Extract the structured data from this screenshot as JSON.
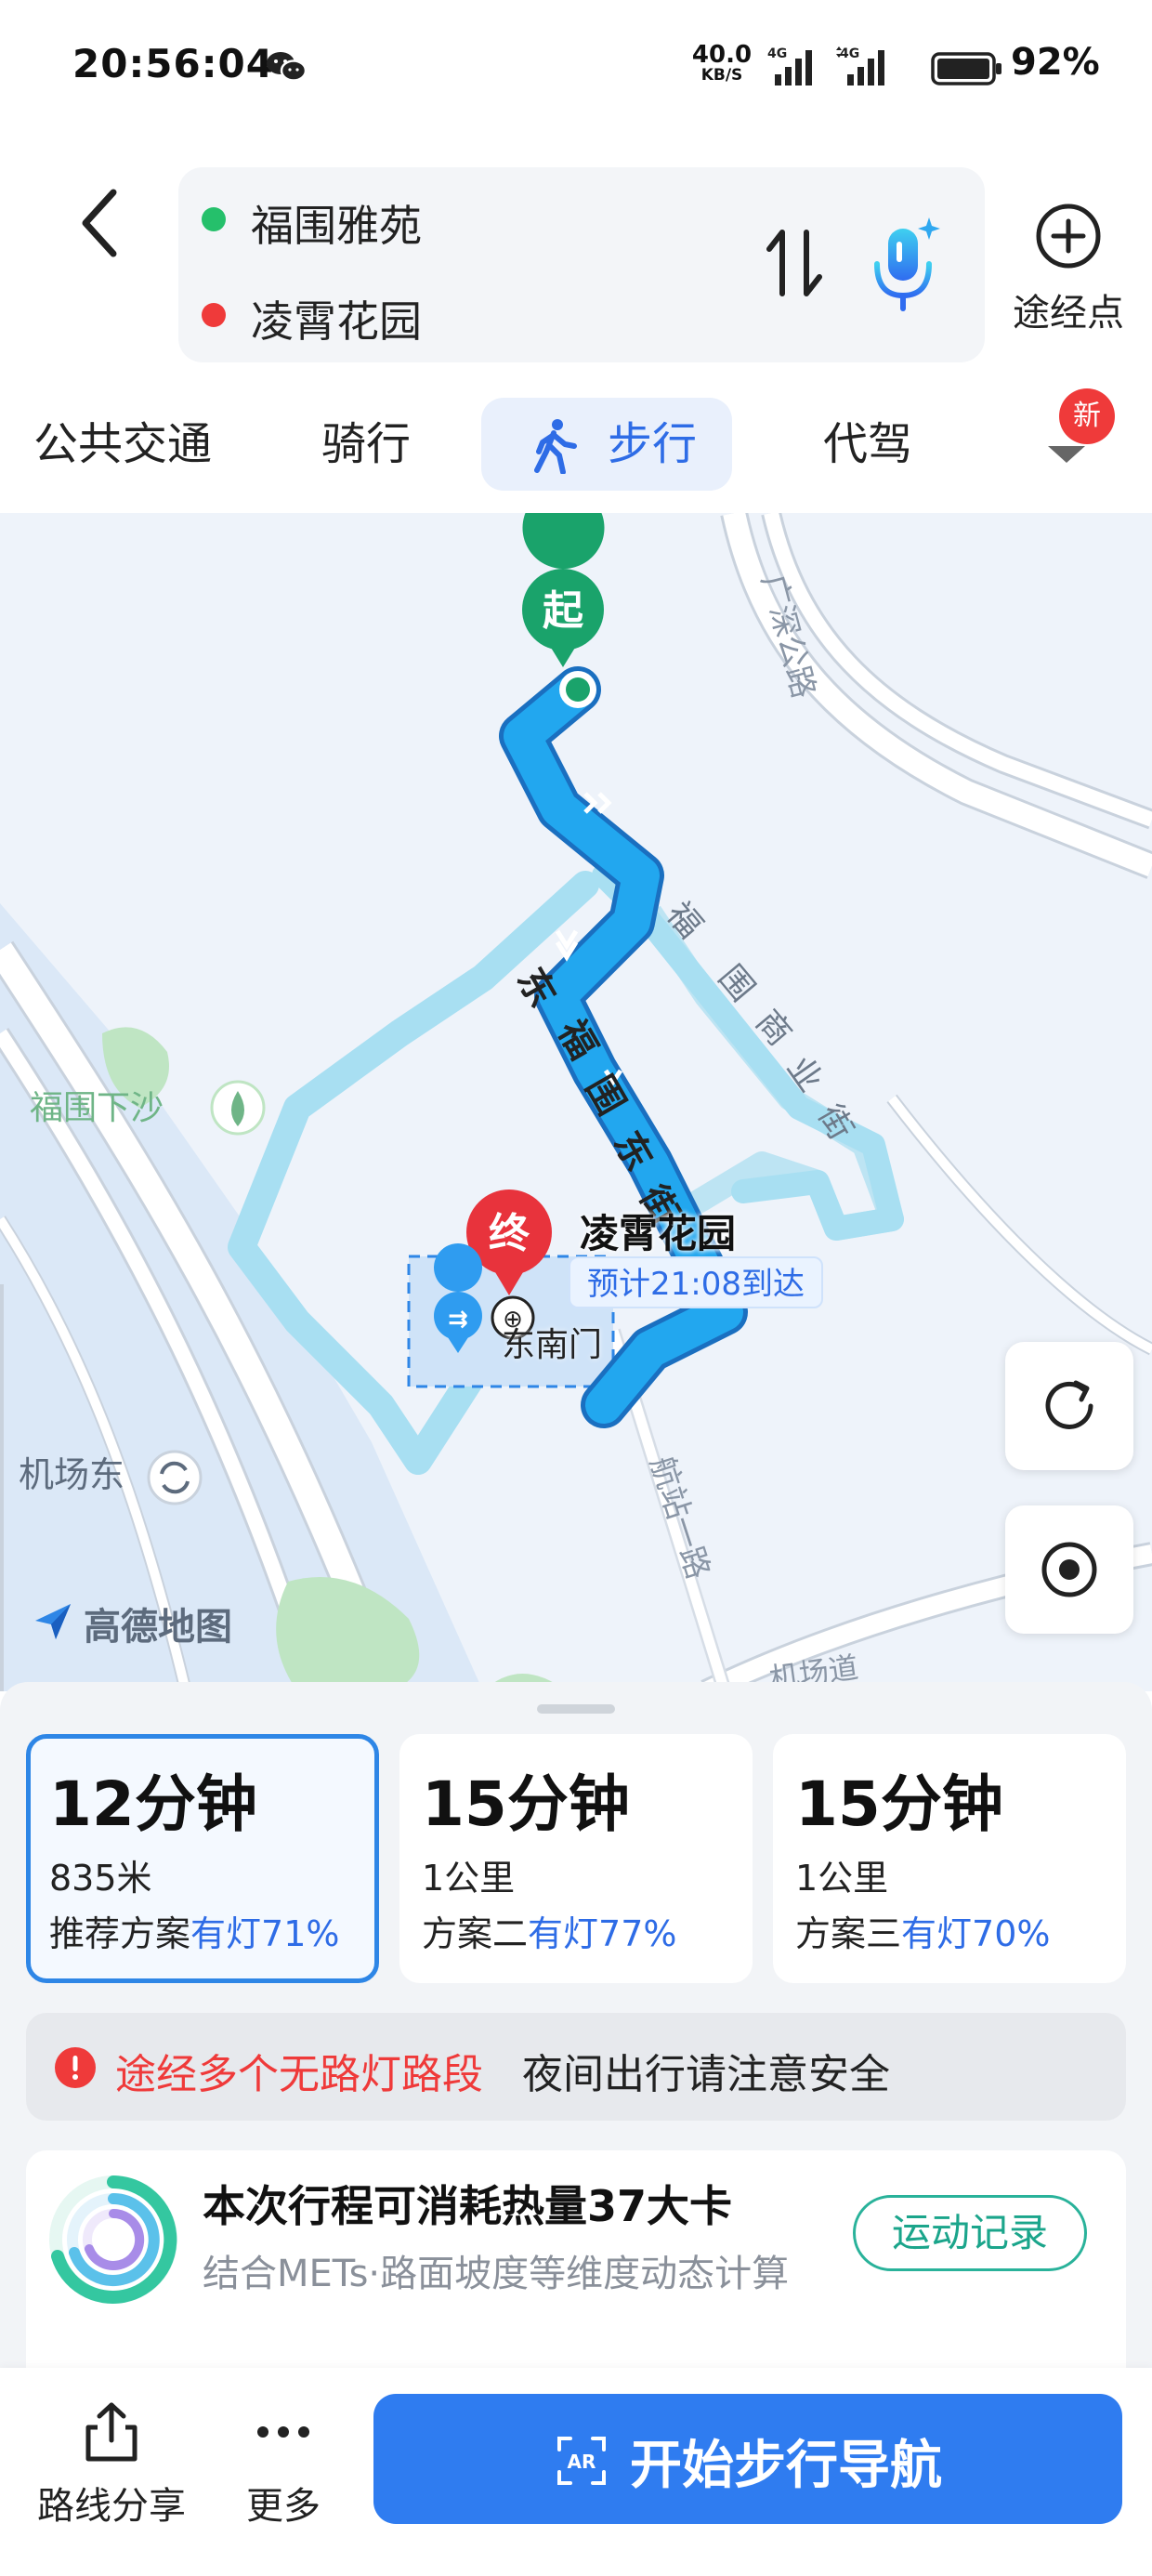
{
  "status_bar": {
    "time": "20:56:04",
    "net_speed": "40.0",
    "net_unit": "KB/S",
    "battery": "92%"
  },
  "header": {
    "origin": "福围雅苑",
    "destination": "凌霄花园",
    "waypoint_label": "途经点"
  },
  "mode_tabs": {
    "transit": "公共交通",
    "bike": "骑行",
    "walk": "步行",
    "driver": "代驾",
    "new_badge": "新"
  },
  "map": {
    "start_marker": "起",
    "end_marker": "终",
    "destination_name": "凌霄花园",
    "eta": "预计21:08到达",
    "gate": "东南门",
    "labels": {
      "road_guangshen": "广深公路",
      "road_fuwei_commercial": "福围商业街",
      "road_fuwei_east": "东福围东街",
      "place_fuwei_xiasha": "福围下沙",
      "place_airport_east": "机场东",
      "road_hangzhan": "航站一路",
      "road_jichang": "机场道"
    },
    "logo": "高德地图"
  },
  "route_options": [
    {
      "duration": "12分钟",
      "distance": "835米",
      "plan": "推荐方案",
      "light": "有灯71%"
    },
    {
      "duration": "15分钟",
      "distance": "1公里",
      "plan": "方案二",
      "light": "有灯77%"
    },
    {
      "duration": "15分钟",
      "distance": "1公里",
      "plan": "方案三",
      "light": "有灯70%"
    }
  ],
  "warning": {
    "highlight": "途经多个无路灯路段",
    "text": "夜间出行请注意安全"
  },
  "calorie": {
    "title": "本次行程可消耗热量37大卡",
    "subtitle": "结合METs·路面坡度等维度动态计算",
    "button": "运动记录"
  },
  "bottom_bar": {
    "share": "路线分享",
    "more": "更多",
    "start": "开始步行导航"
  },
  "colors": {
    "accent": "#2e6ce6",
    "route": "#1a9fe8",
    "start_green": "#1aa36b",
    "end_red": "#e8333c",
    "warning_red": "#ef3a3a",
    "teal": "#1ba58b"
  }
}
